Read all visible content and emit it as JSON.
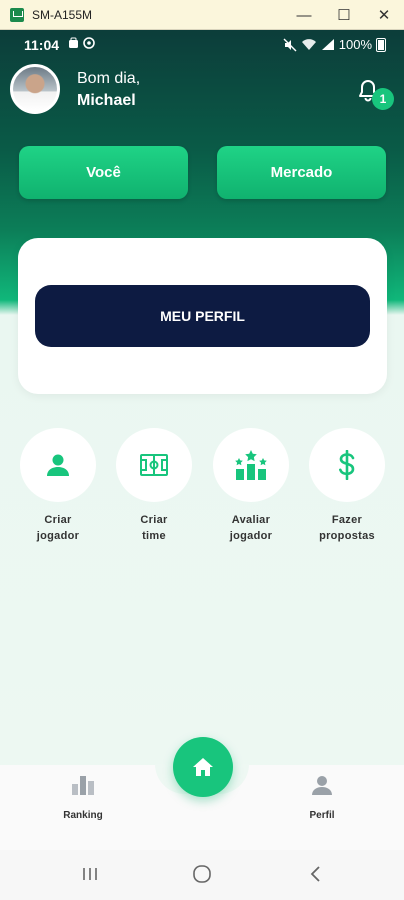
{
  "window": {
    "title": "SM-A155M",
    "controls": {
      "minimize": "—",
      "maximize": "☐",
      "close": "✕"
    }
  },
  "status_bar": {
    "time": "11:04",
    "battery": "100%"
  },
  "header": {
    "greeting": "Bom dia,",
    "name": "Michael",
    "notification_count": "1"
  },
  "tabs": {
    "voce": "Você",
    "mercado": "Mercado"
  },
  "card": {
    "button_label": "MEU PERFIL"
  },
  "actions": [
    {
      "label_line1": "Criar",
      "label_line2": "jogador",
      "icon": "person-icon"
    },
    {
      "label_line1": "Criar",
      "label_line2": "time",
      "icon": "soccer-field-icon"
    },
    {
      "label_line1": "Avaliar",
      "label_line2": "jogador",
      "icon": "ranking-stars-icon"
    },
    {
      "label_line1": "Fazer",
      "label_line2": "propostas",
      "icon": "dollar-icon"
    }
  ],
  "bottom_nav": {
    "ranking": "Ranking",
    "home": "home-icon",
    "perfil": "Perfil"
  },
  "colors": {
    "accent_green": "#18c57d",
    "dark_navy": "#0d1b42",
    "header_dark": "#0c3d3a"
  }
}
